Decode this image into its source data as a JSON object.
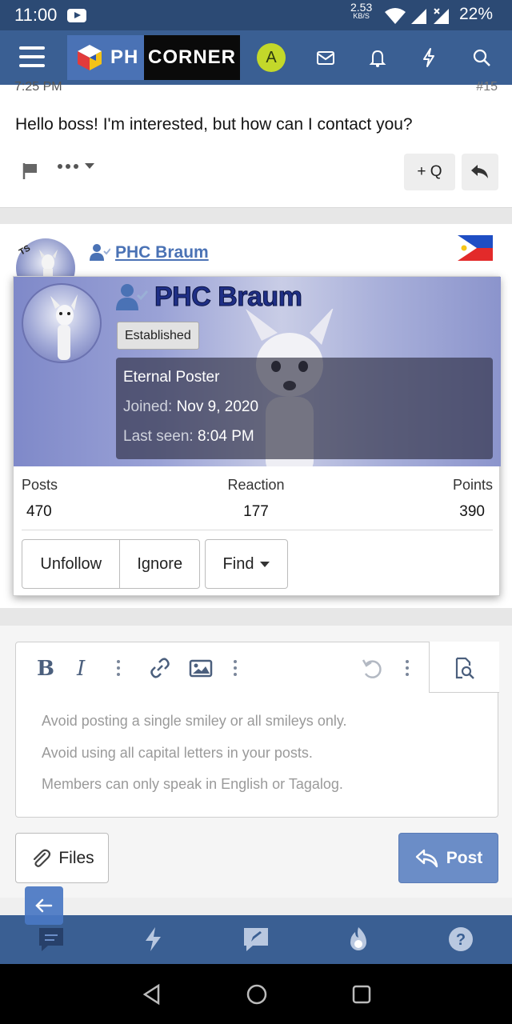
{
  "status_bar": {
    "time": "11:00",
    "net_speed_value": "2.53",
    "net_speed_unit": "KB/S",
    "battery": "22%"
  },
  "header": {
    "logo_left": "PH",
    "logo_right": "CORNER",
    "avatar_letter": "A",
    "icons": [
      "menu-icon",
      "envelope-icon",
      "bell-icon",
      "bolt-icon",
      "search-icon"
    ]
  },
  "post": {
    "timestamp_partial": "7:25 PM",
    "post_number_partial": "#15",
    "message": "Hello boss! I'm interested, but how can I contact you?",
    "quote_label": "+ Q"
  },
  "post2": {
    "ts_badge": "TS",
    "author": "PHC Braum"
  },
  "member_card": {
    "username": "PHC Braum",
    "badge": "Established",
    "title": "Eternal Poster",
    "joined_label": "Joined:",
    "joined_value": "Nov 9, 2020",
    "last_seen_label": "Last seen:",
    "last_seen_value": "8:04 PM",
    "stats": [
      {
        "label": "Posts",
        "value": "470"
      },
      {
        "label": "Reaction",
        "value": "177"
      },
      {
        "label": "Points",
        "value": "390"
      }
    ],
    "buttons": {
      "unfollow": "Unfollow",
      "ignore": "Ignore",
      "find": "Find"
    }
  },
  "editor": {
    "bold": "B",
    "italic": "I",
    "placeholder_lines": [
      "Avoid posting a single smiley or all smileys only.",
      "Avoid using all capital letters in your posts.",
      "Members can only speak in English or Tagalog."
    ],
    "files_label": "Files",
    "post_label": "Post"
  },
  "colors": {
    "header_bg": "#3a5f93",
    "status_bg": "#2c4a74",
    "link": "#4a72b5",
    "post_button": "#6b8dc7"
  }
}
